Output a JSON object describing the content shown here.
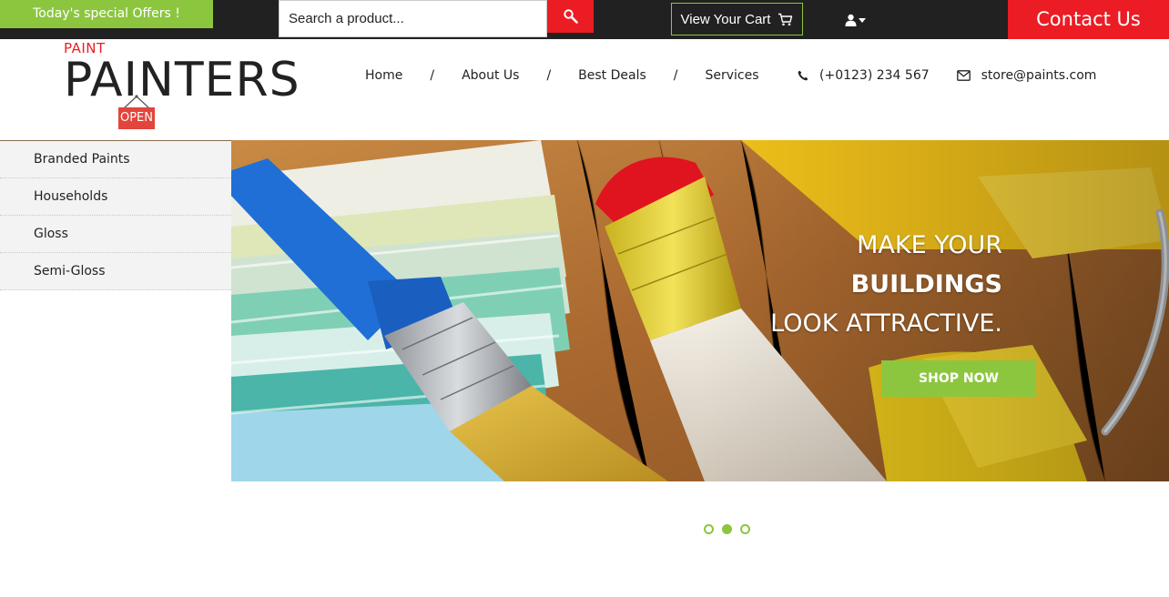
{
  "topbar": {
    "offers_label": "Today's special Offers !",
    "search_placeholder": "Search a product...",
    "cart_label": "View Your Cart",
    "contact_label": "Contact Us"
  },
  "logo": {
    "small": "PAINT",
    "big": "PAINTERS",
    "sign": "OPEN"
  },
  "nav": {
    "items": [
      "Home",
      "About Us",
      "Best Deals",
      "Services"
    ],
    "separator": "/"
  },
  "contact": {
    "phone": "(+0123) 234 567",
    "email": "store@paints.com"
  },
  "sidebar": {
    "items": [
      "Branded Paints",
      "Households",
      "Gloss",
      "Semi-Gloss"
    ]
  },
  "hero": {
    "line1": "MAKE YOUR",
    "line2": "BUILDINGS",
    "line3": "LOOK ATTRACTIVE.",
    "cta": "SHOP NOW"
  },
  "slider": {
    "count": 3,
    "active_index": 1
  },
  "colors": {
    "accent_green": "#8cc63f",
    "accent_red": "#ec1c24",
    "topbar_bg": "#212121"
  },
  "icons": {
    "search": "search-icon",
    "cart": "cart-icon",
    "user": "user-icon",
    "phone": "phone-icon",
    "email": "envelope-icon"
  }
}
